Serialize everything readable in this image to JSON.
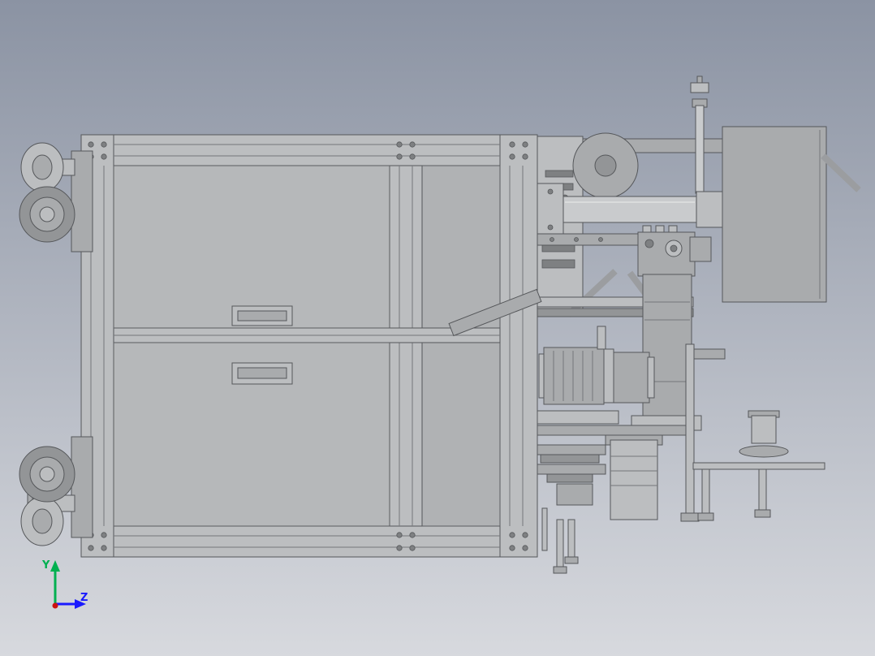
{
  "viewport": {
    "background_top": "#8b93a3",
    "background_bottom": "#d7d9de"
  },
  "triad": {
    "x_color": "#cc1111",
    "y_color": "#00b050",
    "z_color": "#1a1aff",
    "y_label": "Y",
    "z_label": "Z"
  }
}
